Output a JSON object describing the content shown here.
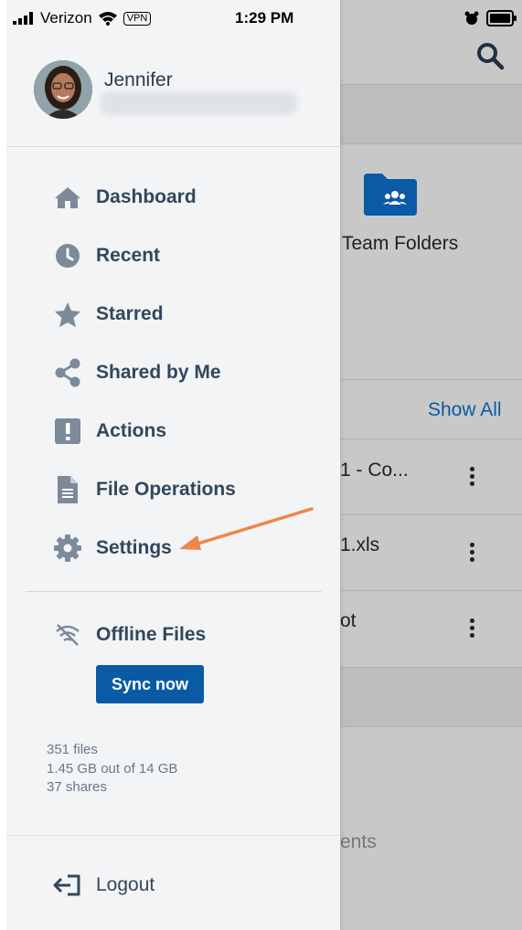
{
  "status_bar": {
    "carrier": "Verizon",
    "vpn": "VPN",
    "time": "1:29 PM"
  },
  "profile": {
    "name": "Jennifer"
  },
  "menu": {
    "items": [
      {
        "label": "Dashboard",
        "icon": "home-icon"
      },
      {
        "label": "Recent",
        "icon": "clock-icon"
      },
      {
        "label": "Starred",
        "icon": "star-icon"
      },
      {
        "label": "Shared by Me",
        "icon": "share-icon"
      },
      {
        "label": "Actions",
        "icon": "exclamation-icon"
      },
      {
        "label": "File Operations",
        "icon": "file-icon"
      },
      {
        "label": "Settings",
        "icon": "gear-icon"
      }
    ]
  },
  "offline": {
    "label": "Offline Files",
    "sync_label": "Sync now"
  },
  "stats": {
    "files": "351 files",
    "storage": "1.45 GB out of 14 GB",
    "shares": "37 shares"
  },
  "logout": {
    "label": "Logout"
  },
  "background": {
    "team_folders": "Team Folders",
    "show_all": "Show All",
    "file1": "1 - Co...",
    "file2": "1.xls",
    "file3": "ot",
    "bottom_text": "ents"
  },
  "colors": {
    "accent": "#0a5aa6",
    "menu_icon": "#7c8a99",
    "annotation_arrow": "#f0844a"
  }
}
